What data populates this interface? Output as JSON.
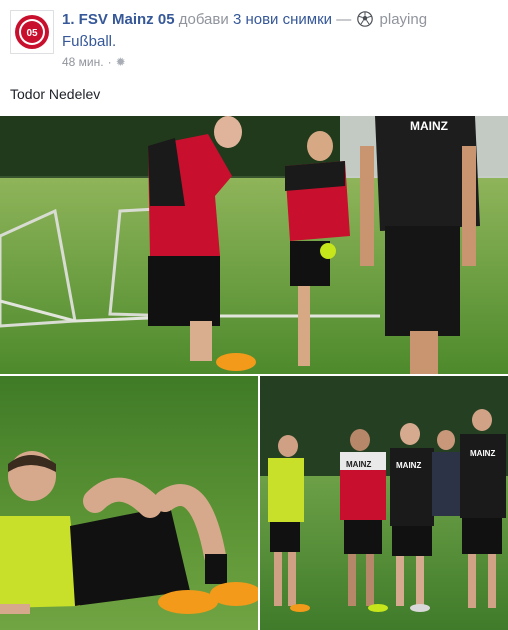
{
  "post": {
    "page_name": "1. FSV Mainz 05",
    "action_text": "добави",
    "photos_link": "3 нови снимки",
    "separator": "—",
    "activity_verb": "playing",
    "activity_object": "Fußball.",
    "timestamp": "48 мин.",
    "meta_separator": "·",
    "caption": "Todor Nedelev",
    "avatar_logo_text": "05",
    "photos": [
      {
        "alt": "Players training on pitch",
        "shirt_text": "MAINZ"
      },
      {
        "alt": "Player resting on grass"
      },
      {
        "alt": "Team huddle at training",
        "shirt_texts": [
          "MAINZ",
          "MAINZ",
          "MAINZ"
        ]
      }
    ]
  },
  "icons": {
    "activity": "soccer-ball-icon",
    "privacy": "gear-icon"
  },
  "colors": {
    "link": "#365899",
    "muted": "#90949c",
    "mainz_red": "#c8102e",
    "grass": "#5a8f35"
  }
}
